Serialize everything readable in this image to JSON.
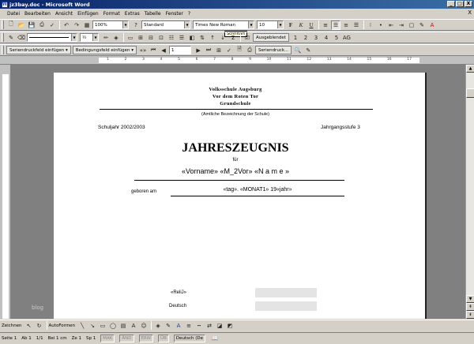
{
  "window": {
    "title": "jz3bay.doc - Microsoft Word",
    "app_icon": "word-icon",
    "controls": [
      "_",
      "□",
      "X"
    ]
  },
  "menubar": {
    "items": [
      "Datei",
      "Bearbeiten",
      "Ansicht",
      "Einfügen",
      "Format",
      "Extras",
      "Tabelle",
      "Fenster",
      "?"
    ],
    "close_label": "X"
  },
  "toolbar_standard": {
    "zoom": "100%",
    "style": "Standard",
    "font": "Times New Roman",
    "font_size": "10",
    "bold_label": "F",
    "italic_label": "K",
    "underline_label": "U",
    "ausgeblendet_label": "Ausgeblendet",
    "heading_levels": [
      "1",
      "2",
      "3",
      "4",
      "5",
      "AG"
    ],
    "line_width": "½"
  },
  "tooltip": {
    "text": "Schriftart"
  },
  "mailmerge_toolbar": {
    "insert_merge_field": "Seriendruckfeld einfügen",
    "insert_word_field": "Bedingungsfeld einfügen",
    "record_number": "1",
    "merge_print": "Seriendruck..."
  },
  "document": {
    "school_line1": "Volksschule Augsburg",
    "school_line2": "Vor dem Roten Tor",
    "school_line3": "Grundschule",
    "official_name_note": "(Amtliche Bezeichnung der Schule)",
    "school_year": "Schuljahr 2002/2003",
    "grade_level": "Jahrgangsstufe 3",
    "doc_title": "JAHRESZEUGNIS",
    "fuer": "für",
    "name_fields": "«Vorname» «M_2Vor» «N a m e »",
    "born_label": "geboren am",
    "birth_fields": "«tag». «MONAT1» 19«jahr»",
    "reli_field": "«ReliJ»",
    "subject_deutsch": "Deutsch"
  },
  "watermark": "blog",
  "drawing_toolbar": {
    "zeichnen": "Zeichnen",
    "autoformen": "AutoFormen"
  },
  "statusbar": {
    "page": "Seite 1",
    "section": "Ab 1",
    "page_of": "1/1",
    "position": "Bei 1 cm",
    "line": "Ze 1",
    "column": "Sp 1",
    "modes": [
      "MAK",
      "ÄND",
      "ERW",
      "ÜB"
    ],
    "language": "Deutsch (De"
  }
}
